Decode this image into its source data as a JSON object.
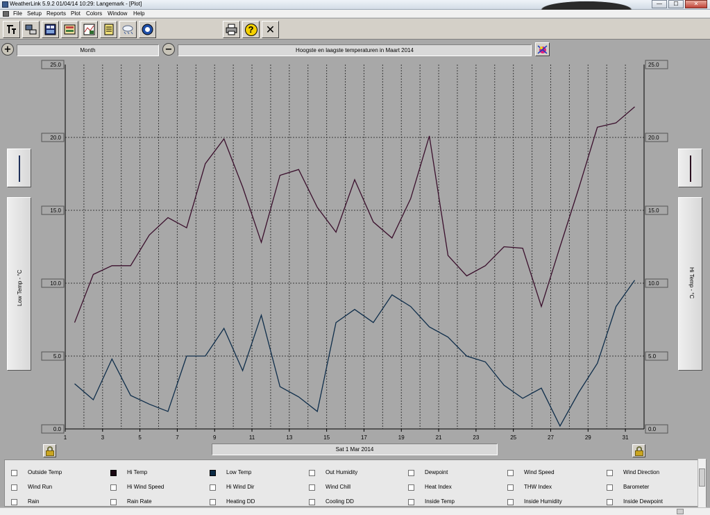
{
  "window": {
    "title": "WeatherLink 5.9.2  01/04/14  10:29: Langemark - [Plot]",
    "minimize": "—",
    "maximize": "☐",
    "close": "✕"
  },
  "menu": [
    "File",
    "Setup",
    "Reports",
    "Plot",
    "Colors",
    "Window",
    "Help"
  ],
  "toolbar": {
    "left_icons": [
      "select-station-icon",
      "download-icon",
      "bulletin-icon",
      "summary-icon",
      "strip-charts-icon",
      "notebook-icon",
      "weather-icon",
      "noaa-icon"
    ],
    "right_icons": [
      "print-icon",
      "help-icon",
      "close-plot-icon"
    ],
    "help_glyph": "?",
    "close_glyph": "✕"
  },
  "controls": {
    "zoom_in": "+",
    "zoom_out": "−",
    "span": "Month",
    "plot_title": "Hoogste en laagste temperaturen in Maart 2014"
  },
  "axis": {
    "left_title": "Low Temp - °C",
    "right_title": "Hi Temp - °C",
    "left_bar_color": "#1e2f5a",
    "right_bar_color": "#2b1020",
    "date_label": "Sat 1 Mar 2014"
  },
  "chart_data": {
    "type": "line",
    "title": "Hoogste en laagste temperaturen in Maart 2014",
    "xlabel": "Sat 1 Mar 2014",
    "ylabel_left": "Low Temp - °C",
    "ylabel_right": "Hi Temp - °C",
    "xlim": [
      1,
      32
    ],
    "ylim": [
      0,
      25
    ],
    "xticks": [
      1,
      3,
      5,
      7,
      9,
      11,
      13,
      15,
      17,
      19,
      21,
      23,
      25,
      27,
      29,
      31
    ],
    "yticks": [
      "0.0",
      "5.0",
      "10.0",
      "15.0",
      "20.0",
      "25.0"
    ],
    "grid": true,
    "x": [
      1.5,
      2.5,
      3.5,
      4.5,
      5.5,
      6.5,
      7.5,
      8.5,
      9.5,
      10.5,
      11.5,
      12.5,
      13.5,
      14.5,
      15.5,
      16.5,
      17.5,
      18.5,
      19.5,
      20.5,
      21.5,
      22.5,
      23.5,
      24.5,
      25.5,
      26.5,
      27.5,
      28.5,
      29.5,
      30.5,
      31.5
    ],
    "series": [
      {
        "name": "Hi Temp",
        "color": "#3a0f2c",
        "values": [
          7.3,
          10.6,
          11.2,
          11.2,
          13.3,
          14.5,
          13.8,
          18.2,
          19.9,
          16.6,
          12.8,
          17.4,
          17.8,
          15.2,
          13.5,
          17.1,
          14.2,
          13.1,
          15.8,
          20.1,
          11.9,
          10.5,
          11.2,
          12.5,
          12.4,
          8.4,
          12.5,
          16.5,
          20.7,
          21.0,
          22.1
        ]
      },
      {
        "name": "Low Temp",
        "color": "#0e2d4a",
        "values": [
          3.1,
          2.0,
          4.8,
          2.3,
          1.7,
          1.2,
          5.0,
          5.0,
          6.9,
          4.0,
          7.8,
          2.9,
          2.2,
          1.2,
          7.3,
          8.2,
          7.3,
          9.2,
          8.4,
          7.0,
          6.3,
          5.0,
          4.6,
          3.0,
          2.1,
          2.8,
          0.2,
          2.5,
          4.5,
          8.4,
          10.2
        ]
      }
    ]
  },
  "legend": {
    "rows": [
      [
        "Outside Temp",
        "Hi Temp",
        "Low Temp",
        "Out Humidity",
        "Dewpoint",
        "Wind Speed",
        "Wind Direction"
      ],
      [
        "Wind Run",
        "Hi Wind Speed",
        "Hi Wind Dir",
        "Wind Chill",
        "Heat Index",
        "THW Index",
        "Barometer"
      ],
      [
        "Rain",
        "Rain Rate",
        "Heating DD",
        "Cooling DD",
        "Inside Temp",
        "Inside Humidity",
        "Inside Dewpoint"
      ]
    ],
    "checked_colors": {
      "Hi Temp": "#1a0712",
      "Low Temp": "#0b2a44"
    }
  }
}
